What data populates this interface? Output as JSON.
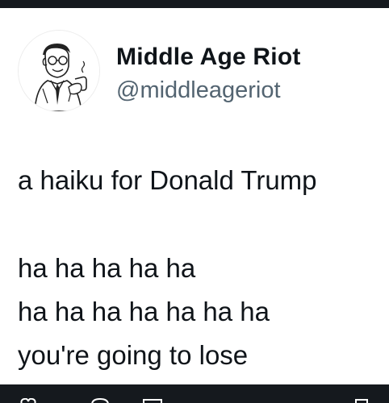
{
  "author": {
    "display_name": "Middle Age Riot",
    "handle": "@middleageriot",
    "avatar_icon": "retro-man-pipe-avatar"
  },
  "tweet": {
    "lines": [
      "a haiku for Donald Trump",
      "ha ha ha ha ha",
      "ha ha ha ha ha ha ha",
      "you're going to lose"
    ]
  },
  "action_bar": {
    "icons": [
      "heart-icon",
      "comment-icon",
      "share-icon",
      "bookmark-icon"
    ]
  },
  "colors": {
    "text": "#0f1419",
    "secondary_text": "#536471",
    "bars": "#15191e"
  }
}
